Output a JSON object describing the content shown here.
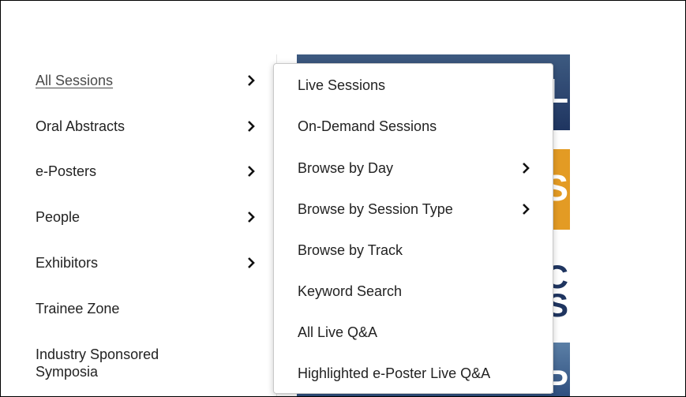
{
  "left_menu": {
    "items": [
      {
        "label": "All Sessions",
        "has_submenu": true,
        "active": true
      },
      {
        "label": "Oral Abstracts",
        "has_submenu": true
      },
      {
        "label": "e-Posters",
        "has_submenu": true
      },
      {
        "label": "People",
        "has_submenu": true
      },
      {
        "label": "Exhibitors",
        "has_submenu": true
      },
      {
        "label": "Trainee Zone",
        "has_submenu": false
      },
      {
        "label": "Industry Sponsored Symposia",
        "has_submenu": false
      }
    ]
  },
  "submenu": {
    "items": [
      {
        "label": "Live Sessions",
        "has_submenu": false
      },
      {
        "label": "On-Demand Sessions",
        "has_submenu": false
      },
      {
        "label": "Browse by Day",
        "has_submenu": true
      },
      {
        "label": "Browse by Session Type",
        "has_submenu": true
      },
      {
        "label": "Browse by Track",
        "has_submenu": false
      },
      {
        "label": "Keyword Search",
        "has_submenu": false
      },
      {
        "label": "All Live Q&A",
        "has_submenu": false
      },
      {
        "label": "Highlighted e-Poster Live Q&A",
        "has_submenu": false
      }
    ]
  },
  "background_banners": {
    "top_fragment": "L",
    "orange_fragment": "S",
    "mid_fragment_1": "C",
    "mid_fragment_2": "S",
    "bottom_fragment": "P"
  },
  "colors": {
    "banner_navy": "#1f3560",
    "banner_orange": "#e39b24",
    "text": "#222222"
  },
  "icons": {
    "submenu_indicator": "chevron-right-icon"
  }
}
